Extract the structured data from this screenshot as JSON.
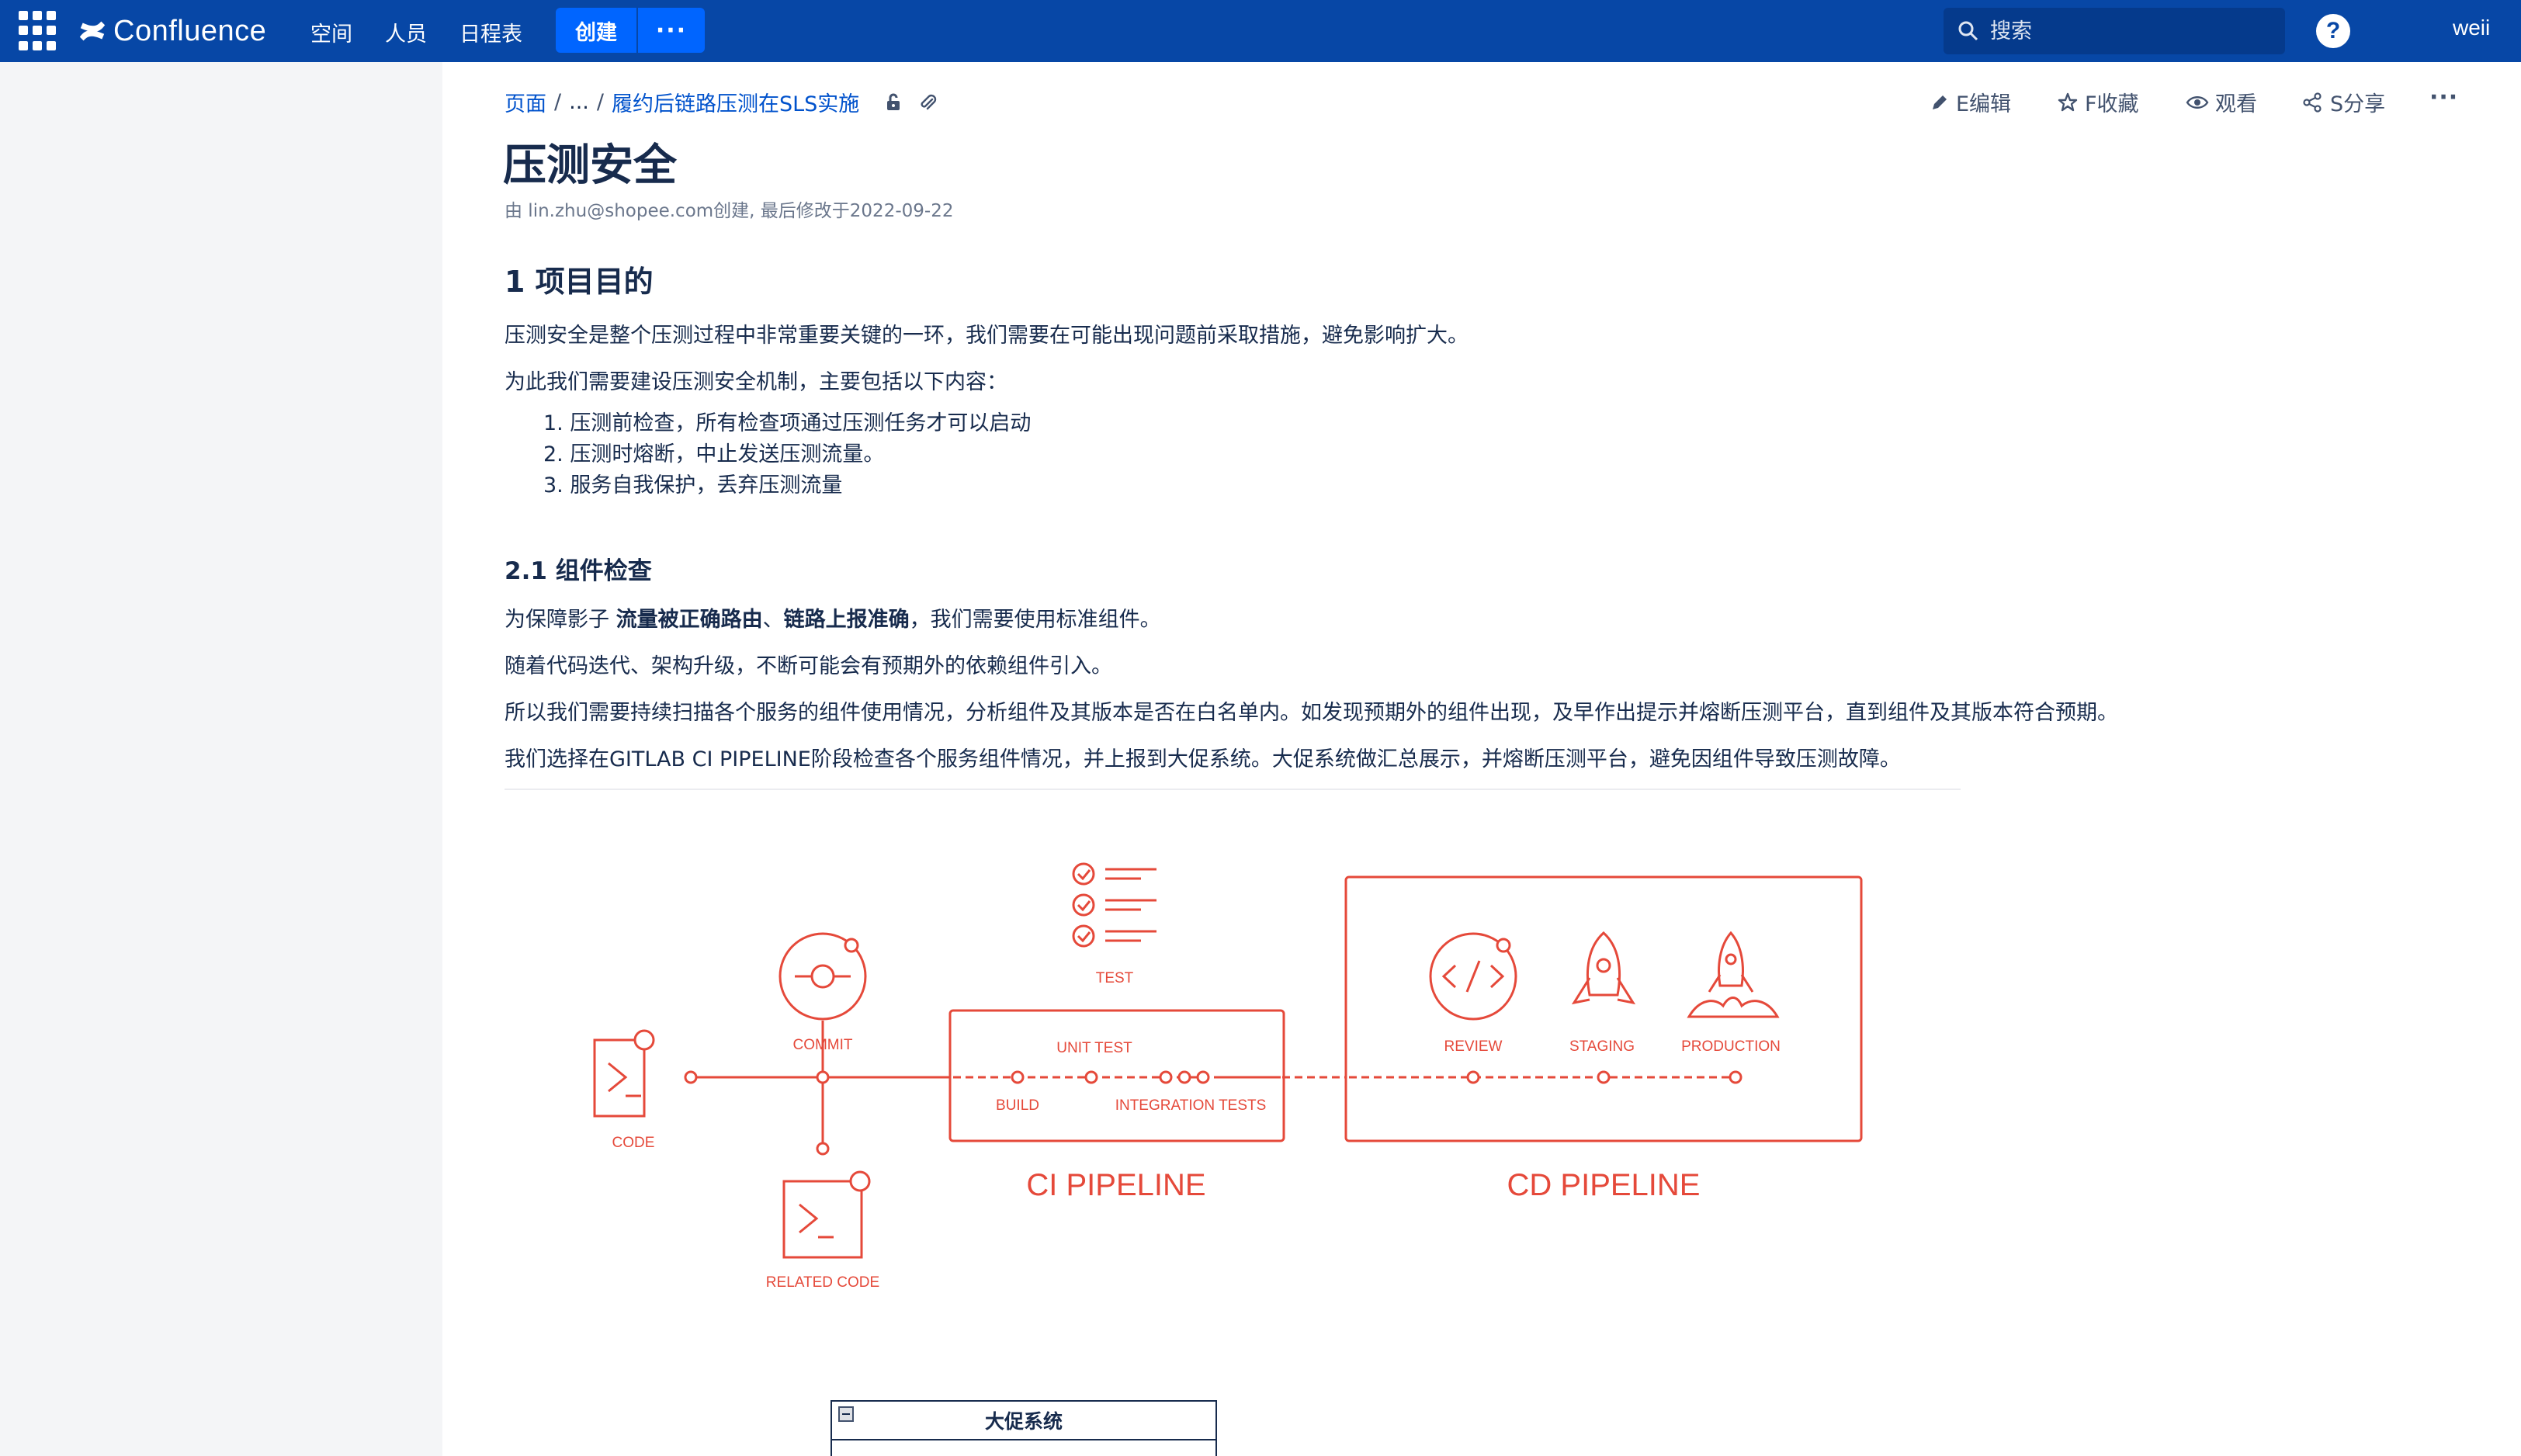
{
  "topbar": {
    "app_name": "Confluence",
    "nav": [
      "空间",
      "人员",
      "日程表"
    ],
    "create_label": "创建",
    "more_label": "···",
    "search_placeholder": "搜索",
    "help_label": "?",
    "user": "weii"
  },
  "breadcrumb": {
    "root": "页面",
    "ellipsis": "...",
    "parent": "履约后链路压测在SLS实施"
  },
  "actions": {
    "edit": "E编辑",
    "favorite": "F收藏",
    "watch": "观看",
    "share": "S分享",
    "more": "···"
  },
  "page": {
    "title": "压测安全",
    "meta": "由 lin.zhu@shopee.com创建, 最后修改于2022-09-22",
    "section1_heading": "1 项目目的",
    "section1_p1": "压测安全是整个压测过程中非常重要关键的一环，我们需要在可能出现问题前采取措施，避免影响扩大。",
    "section1_p2": "为此我们需要建设压测安全机制，主要包括以下内容：",
    "list": [
      "1. 压测前检查，所有检查项通过压测任务才可以启动",
      "2. 压测时熔断，中止发送压测流量。",
      "3. 服务自我保护，丢弃压测流量"
    ],
    "section2_heading": "2.1 组件检查",
    "s2_p1_prefix": "为保障影子 ",
    "s2_p1_bold1": "流量被正确路由",
    "s2_p1_mid": "、",
    "s2_p1_bold2": "链路上报准确",
    "s2_p1_suffix": "，我们需要使用标准组件。",
    "s2_p2": "随着代码迭代、架构升级，不断可能会有预期外的依赖组件引入。",
    "s2_p3": "所以我们需要持续扫描各个服务的组件使用情况，分析组件及其版本是否在白名单内。如发现预期外的组件出现，及早作出提示并熔断压测平台，直到组件及其版本符合预期。",
    "s2_p4": "我们选择在GITLAB CI PIPELINE阶段检查各个服务组件情况，并上报到大促系统。大促系统做汇总展示，并熔断压测平台，避免因组件导致压测故障。"
  },
  "diagram": {
    "accent": "#e5493a",
    "labels": {
      "code": "CODE",
      "commit": "COMMIT",
      "related_code": "RELATED CODE",
      "test": "TEST",
      "unit_test": "UNIT TEST",
      "build": "BUILD",
      "integration_tests": "INTEGRATION TESTS",
      "ci_pipeline": "CI PIPELINE",
      "review": "REVIEW",
      "staging": "STAGING",
      "production": "PRODUCTION",
      "cd_pipeline": "CD PIPELINE"
    }
  },
  "table": {
    "title": "大促系统"
  },
  "colors": {
    "topbar": "#0747a6",
    "create": "#0065ff",
    "link": "#0052cc",
    "text": "#172b4d"
  }
}
